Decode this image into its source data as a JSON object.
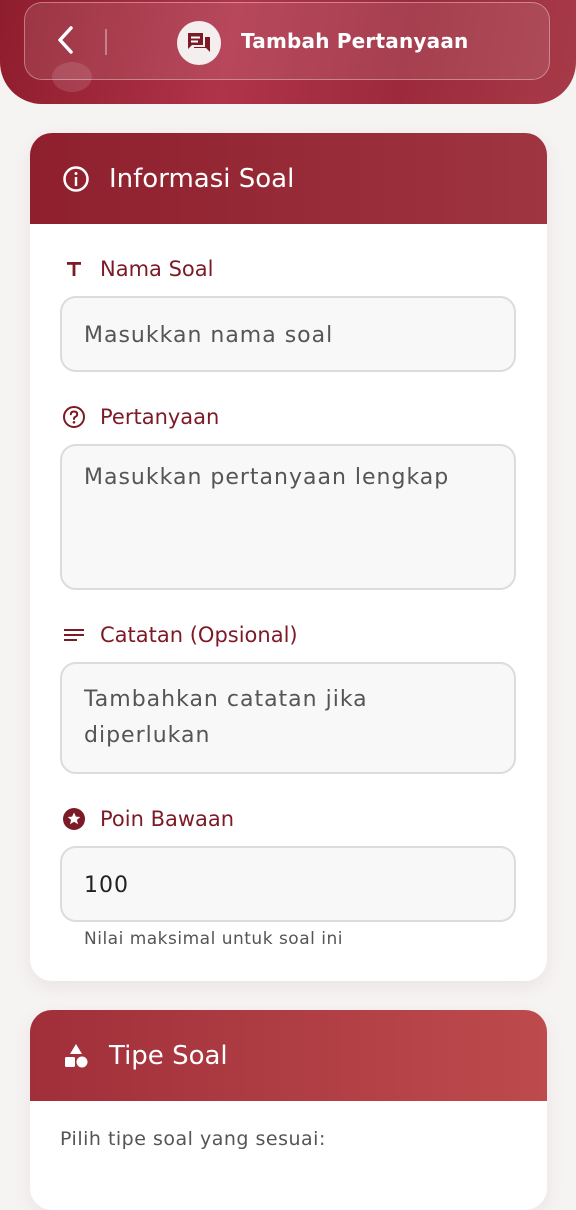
{
  "header": {
    "title": "Tambah Pertanyaan",
    "back_icon": "chevron-left-icon",
    "title_icon": "chat-bubble-icon"
  },
  "info_card": {
    "title": "Informasi Soal",
    "icon": "info-icon",
    "fields": {
      "nama_soal": {
        "label": "Nama Soal",
        "icon": "text-format-icon",
        "placeholder": "Masukkan nama soal"
      },
      "pertanyaan": {
        "label": "Pertanyaan",
        "icon": "question-circle-icon",
        "placeholder": "Masukkan pertanyaan lengkap"
      },
      "catatan": {
        "label": "Catatan (Opsional)",
        "icon": "notes-lines-icon",
        "placeholder": "Tambahkan catatan jika diperlukan"
      },
      "poin": {
        "label": "Poin Bawaan",
        "icon": "star-badge-icon",
        "value": "100",
        "helper": "Nilai maksimal untuk soal ini"
      }
    }
  },
  "type_card": {
    "title": "Tipe Soal",
    "icon": "shapes-icon",
    "subtitle": "Pilih tipe soal yang sesuai:"
  },
  "colors": {
    "primary": "#8f1f2d",
    "label": "#7c1a26",
    "background": "#f6f3f3"
  }
}
